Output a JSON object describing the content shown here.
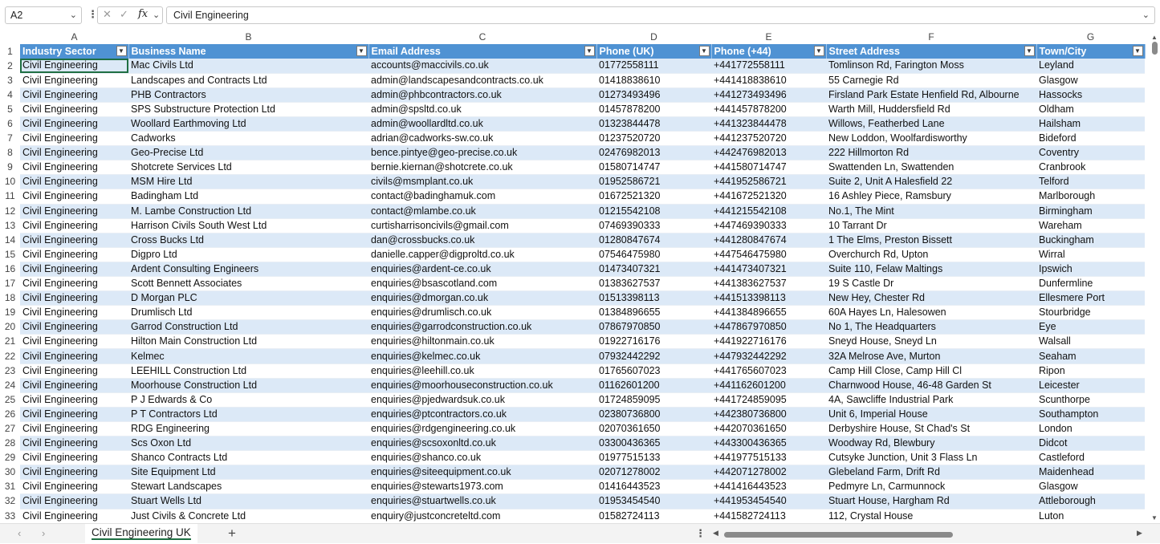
{
  "formula_bar": {
    "name_box": "A2",
    "fx_label": "fx",
    "cancel_glyph": "✕",
    "confirm_glyph": "✓",
    "formula": "Civil Engineering"
  },
  "columns": [
    "A",
    "B",
    "C",
    "D",
    "E",
    "F",
    "G"
  ],
  "headers": [
    "Industry Sector",
    "Business Name",
    "Email Address",
    "Phone (UK)",
    "Phone (+44)",
    "Street Address",
    "Town/City"
  ],
  "rows": [
    [
      "Civil Engineering",
      "Mac Civils Ltd",
      "accounts@maccivils.co.uk",
      "01772558111",
      "+441772558111",
      "Tomlinson Rd, Farington Moss",
      "Leyland"
    ],
    [
      "Civil Engineering",
      "Landscapes and Contracts Ltd",
      "admin@landscapesandcontracts.co.uk",
      "01418838610",
      "+441418838610",
      "55 Carnegie Rd",
      "Glasgow"
    ],
    [
      "Civil Engineering",
      "PHB Contractors",
      "admin@phbcontractors.co.uk",
      "01273493496",
      "+441273493496",
      "Firsland Park Estate Henfield Rd, Albourne",
      "Hassocks"
    ],
    [
      "Civil Engineering",
      "SPS Substructure Protection Ltd",
      "admin@spsltd.co.uk",
      "01457878200",
      "+441457878200",
      "Warth Mill, Huddersfield Rd",
      "Oldham"
    ],
    [
      "Civil Engineering",
      "Woollard Earthmoving Ltd",
      "admin@woollardltd.co.uk",
      "01323844478",
      "+441323844478",
      "Willows, Featherbed Lane",
      "Hailsham"
    ],
    [
      "Civil Engineering",
      "Cadworks",
      "adrian@cadworks-sw.co.uk",
      "01237520720",
      "+441237520720",
      "New Loddon, Woolfardisworthy",
      "Bideford"
    ],
    [
      "Civil Engineering",
      "Geo-Precise Ltd",
      "bence.pintye@geo-precise.co.uk",
      "02476982013",
      "+442476982013",
      "222 Hillmorton Rd",
      "Coventry"
    ],
    [
      "Civil Engineering",
      "Shotcrete Services Ltd",
      "bernie.kiernan@shotcrete.co.uk",
      "01580714747",
      "+441580714747",
      "Swattenden Ln, Swattenden",
      "Cranbrook"
    ],
    [
      "Civil Engineering",
      "MSM Hire Ltd",
      "civils@msmplant.co.uk",
      "01952586721",
      "+441952586721",
      "Suite 2, Unit A Halesfield 22",
      "Telford"
    ],
    [
      "Civil Engineering",
      "Badingham Ltd",
      "contact@badinghamuk.com",
      "01672521320",
      "+441672521320",
      "16 Ashley Piece, Ramsbury",
      "Marlborough"
    ],
    [
      "Civil Engineering",
      "M. Lambe Construction Ltd",
      "contact@mlambe.co.uk",
      "01215542108",
      "+441215542108",
      "No.1, The Mint",
      "Birmingham"
    ],
    [
      "Civil Engineering",
      "Harrison Civils South West Ltd",
      "curtisharrisoncivils@gmail.com",
      "07469390333",
      "+447469390333",
      "10 Tarrant Dr",
      "Wareham"
    ],
    [
      "Civil Engineering",
      "Cross Bucks Ltd",
      "dan@crossbucks.co.uk",
      "01280847674",
      "+441280847674",
      "1 The Elms, Preston Bissett",
      "Buckingham"
    ],
    [
      "Civil Engineering",
      "Digpro Ltd",
      "danielle.capper@digproltd.co.uk",
      "07546475980",
      "+447546475980",
      "Overchurch Rd, Upton",
      "Wirral"
    ],
    [
      "Civil Engineering",
      "Ardent Consulting Engineers",
      "enquiries@ardent-ce.co.uk",
      "01473407321",
      "+441473407321",
      "Suite 110, Felaw Maltings",
      "Ipswich"
    ],
    [
      "Civil Engineering",
      "Scott Bennett Associates",
      "enquiries@bsascotland.com",
      "01383627537",
      "+441383627537",
      "19 S Castle Dr",
      "Dunfermline"
    ],
    [
      "Civil Engineering",
      "D Morgan PLC",
      "enquiries@dmorgan.co.uk",
      "01513398113",
      "+441513398113",
      "New Hey, Chester Rd",
      "Ellesmere Port"
    ],
    [
      "Civil Engineering",
      "Drumlisch Ltd",
      "enquiries@drumlisch.co.uk",
      "01384896655",
      "+441384896655",
      "60A Hayes Ln, Halesowen",
      "Stourbridge"
    ],
    [
      "Civil Engineering",
      "Garrod Construction Ltd",
      "enquiries@garrodconstruction.co.uk",
      "07867970850",
      "+447867970850",
      "No 1, The Headquarters",
      "Eye"
    ],
    [
      "Civil Engineering",
      "Hilton Main Construction Ltd",
      "enquiries@hiltonmain.co.uk",
      "01922716176",
      "+441922716176",
      "Sneyd House, Sneyd Ln",
      "Walsall"
    ],
    [
      "Civil Engineering",
      "Kelmec",
      "enquiries@kelmec.co.uk",
      "07932442292",
      "+447932442292",
      "32A Melrose Ave, Murton",
      "Seaham"
    ],
    [
      "Civil Engineering",
      "LEEHILL Construction Ltd",
      "enquiries@leehill.co.uk",
      "01765607023",
      "+441765607023",
      "Camp Hill Close, Camp Hill Cl",
      "Ripon"
    ],
    [
      "Civil Engineering",
      "Moorhouse Construction Ltd",
      "enquiries@moorhouseconstruction.co.uk",
      "01162601200",
      "+441162601200",
      "Charnwood House, 46-48 Garden St",
      "Leicester"
    ],
    [
      "Civil Engineering",
      "P J Edwards & Co",
      "enquiries@pjedwardsuk.co.uk",
      "01724859095",
      "+441724859095",
      "4A, Sawcliffe Industrial Park",
      "Scunthorpe"
    ],
    [
      "Civil Engineering",
      "P T Contractors Ltd",
      "enquiries@ptcontractors.co.uk",
      "02380736800",
      "+442380736800",
      "Unit 6, Imperial House",
      "Southampton"
    ],
    [
      "Civil Engineering",
      "RDG Engineering",
      "enquiries@rdgengineering.co.uk",
      "02070361650",
      "+442070361650",
      "Derbyshire House, St Chad's St",
      "London"
    ],
    [
      "Civil Engineering",
      "Scs Oxon Ltd",
      "enquiries@scsoxonltd.co.uk",
      "03300436365",
      "+443300436365",
      "Woodway Rd, Blewbury",
      "Didcot"
    ],
    [
      "Civil Engineering",
      "Shanco Contracts Ltd",
      "enquiries@shanco.co.uk",
      "01977515133",
      "+441977515133",
      "Cutsyke Junction, Unit 3 Flass Ln",
      "Castleford"
    ],
    [
      "Civil Engineering",
      "Site Equipment Ltd",
      "enquiries@siteequipment.co.uk",
      "02071278002",
      "+442071278002",
      "Glebeland Farm, Drift Rd",
      "Maidenhead"
    ],
    [
      "Civil Engineering",
      "Stewart Landscapes",
      "enquiries@stewarts1973.com",
      "01416443523",
      "+441416443523",
      "Pedmyre Ln, Carmunnock",
      "Glasgow"
    ],
    [
      "Civil Engineering",
      "Stuart Wells Ltd",
      "enquiries@stuartwells.co.uk",
      "01953454540",
      "+441953454540",
      "Stuart House, Hargham Rd",
      "Attleborough"
    ],
    [
      "Civil Engineering",
      "Just Civils & Concrete Ltd",
      "enquiry@justconcreteltd.com",
      "01582724113",
      "+441582724113",
      "112, Crystal House",
      "Luton"
    ]
  ],
  "sheet_tab": "Civil Engineering UK",
  "add_sheet_glyph": "+",
  "colors": {
    "header_bg": "#4f92d3",
    "band_bg": "#dce9f7",
    "accent": "#1f6f43"
  }
}
